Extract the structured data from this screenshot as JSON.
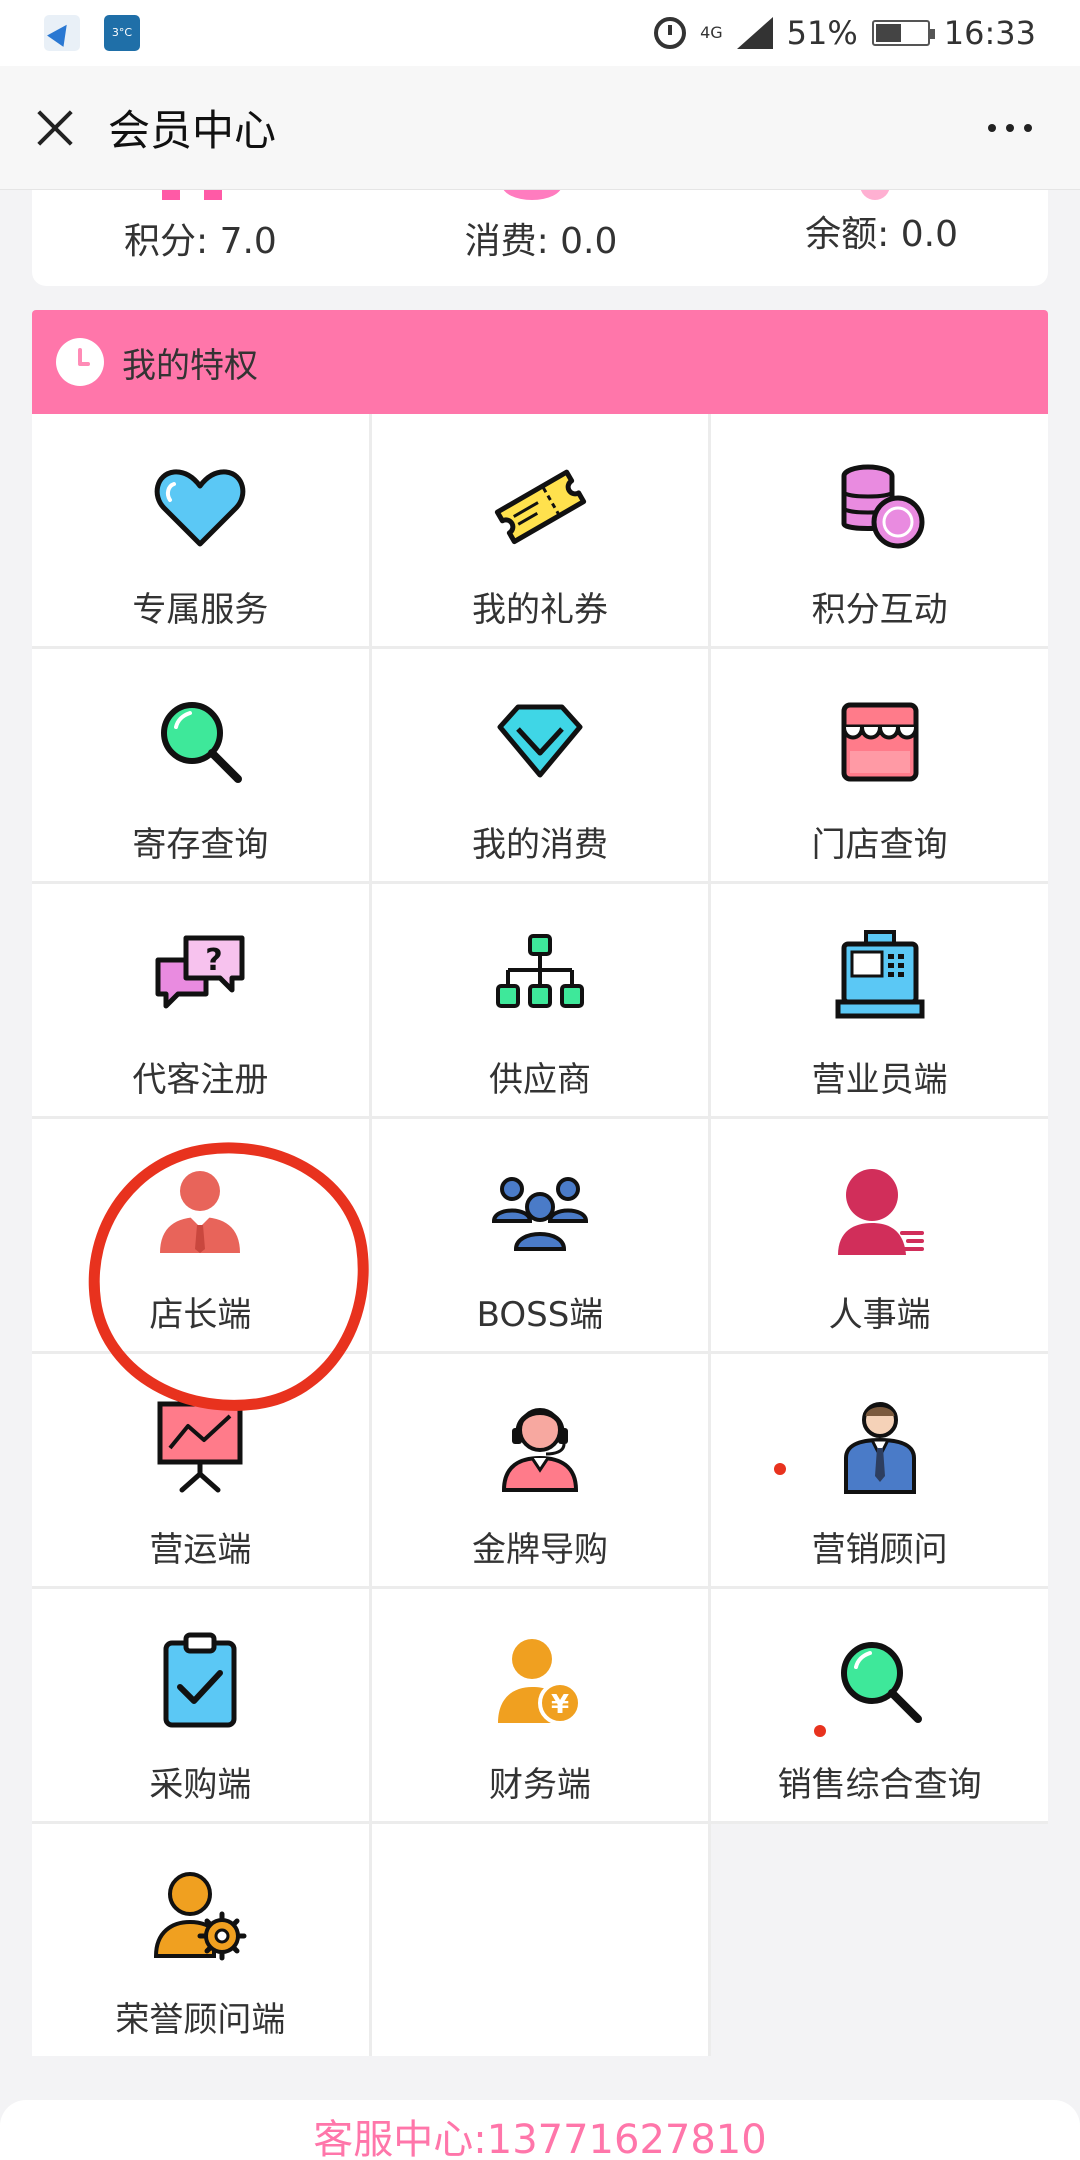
{
  "status_bar": {
    "net": "4G",
    "battery": "51%",
    "battery_level": 0.51,
    "time": "16:33",
    "weather_badge": "3°C"
  },
  "header": {
    "title": "会员中心"
  },
  "stats": {
    "points": "积分: 7.0",
    "consumption": "消费: 0.0",
    "balance": "余额: 0.0"
  },
  "privileges": {
    "title": "我的特权",
    "items": [
      {
        "label": "专属服务",
        "icon": "heart-icon"
      },
      {
        "label": "我的礼券",
        "icon": "ticket-icon"
      },
      {
        "label": "积分互动",
        "icon": "coins-icon"
      },
      {
        "label": "寄存查询",
        "icon": "magnifier-icon"
      },
      {
        "label": "我的消费",
        "icon": "diamond-icon"
      },
      {
        "label": "门店查询",
        "icon": "store-icon"
      },
      {
        "label": "代客注册",
        "icon": "question-chat-icon"
      },
      {
        "label": "供应商",
        "icon": "org-chart-icon"
      },
      {
        "label": "营业员端",
        "icon": "cash-register-icon"
      },
      {
        "label": "店长端",
        "icon": "manager-icon"
      },
      {
        "label": "BOSS端",
        "icon": "team-icon"
      },
      {
        "label": "人事端",
        "icon": "person-fast-icon"
      },
      {
        "label": "营运端",
        "icon": "presentation-board-icon"
      },
      {
        "label": "金牌导购",
        "icon": "headset-agent-icon"
      },
      {
        "label": "营销顾问",
        "icon": "businessman-icon"
      },
      {
        "label": "采购端",
        "icon": "clipboard-check-icon"
      },
      {
        "label": "财务端",
        "icon": "person-yuan-icon"
      },
      {
        "label": "销售综合查询",
        "icon": "magnifier-icon"
      },
      {
        "label": "荣誉顾问端",
        "icon": "person-gear-icon"
      }
    ]
  },
  "footer": {
    "service": "客服中心:13771627810"
  },
  "colors": {
    "accent_pink": "#ff76aa",
    "annotation_red": "#e8321e"
  }
}
